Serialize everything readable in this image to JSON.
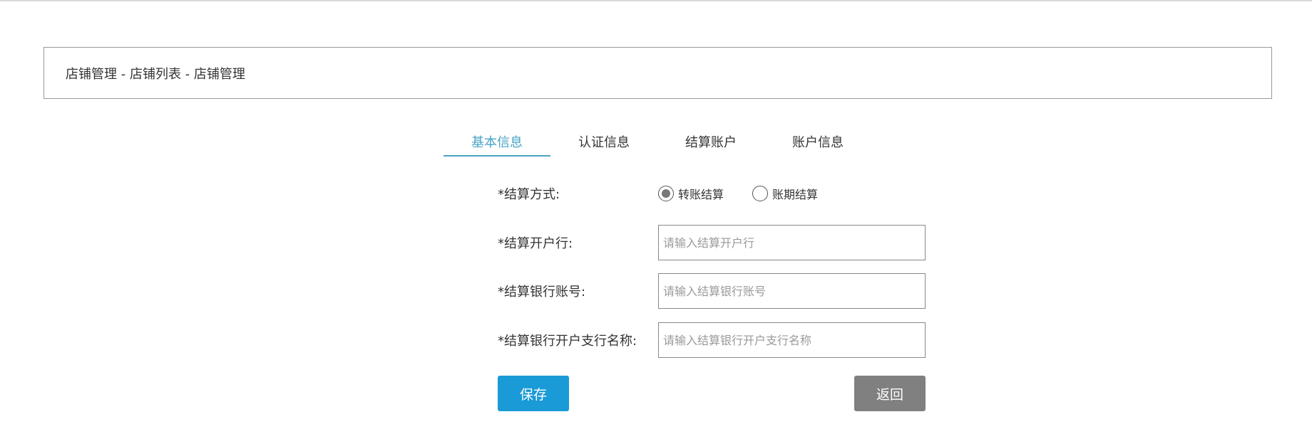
{
  "breadcrumb": {
    "text": "店铺管理 - 店铺列表 - 店铺管理"
  },
  "tabs": [
    {
      "label": "基本信息",
      "active": true
    },
    {
      "label": "认证信息",
      "active": false
    },
    {
      "label": "结算账户",
      "active": false
    },
    {
      "label": "账户信息",
      "active": false
    }
  ],
  "form": {
    "settlement_method": {
      "label": "*结算方式:",
      "options": [
        {
          "label": "转账结算",
          "selected": true
        },
        {
          "label": "账期结算",
          "selected": false
        }
      ]
    },
    "bank": {
      "label": "*结算开户行:",
      "value": "",
      "placeholder": "请输入结算开户行"
    },
    "account_number": {
      "label": "*结算银行账号:",
      "value": "",
      "placeholder": "请输入结算银行账号"
    },
    "branch_name": {
      "label": "*结算银行开户支行名称:",
      "value": "",
      "placeholder": "请输入结算银行开户支行名称"
    }
  },
  "actions": {
    "save_label": "保存",
    "back_label": "返回"
  },
  "colors": {
    "accent": "#4aa3c6",
    "save_button": "#1a9ad6",
    "back_button": "#808080"
  }
}
